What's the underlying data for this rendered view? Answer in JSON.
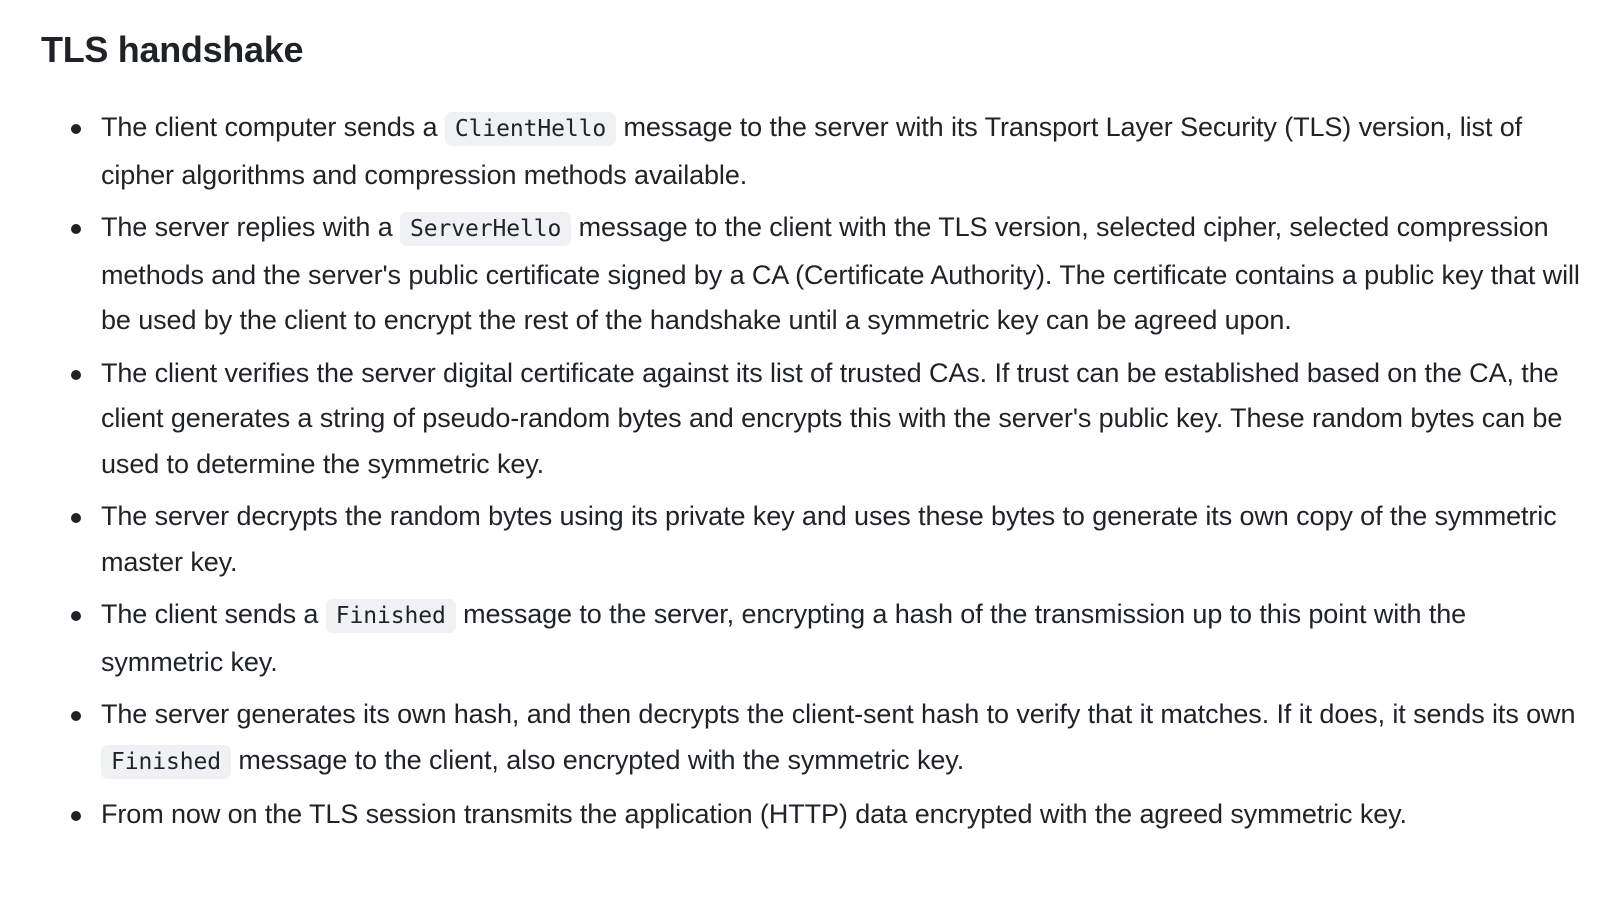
{
  "heading": "TLS handshake",
  "items": [
    {
      "before": "The client computer sends a ",
      "code": "ClientHello",
      "after": " message to the server with its Transport Layer Security (TLS) version, list of cipher algorithms and compression methods available."
    },
    {
      "before": "The server replies with a ",
      "code": "ServerHello",
      "after": " message to the client with the TLS version, selected cipher, selected compression methods and the server's public certificate signed by a CA (Certificate Authority). The certificate contains a public key that will be used by the client to encrypt the rest of the handshake until a symmetric key can be agreed upon."
    },
    {
      "before": "The client verifies the server digital certificate against its list of trusted CAs. If trust can be established based on the CA, the client generates a string of pseudo-random bytes and encrypts this with the server's public key. These random bytes can be used to determine the symmetric key."
    },
    {
      "before": "The server decrypts the random bytes using its private key and uses these bytes to generate its own copy of the symmetric master key."
    },
    {
      "before": "The client sends a ",
      "code": "Finished",
      "after": " message to the server, encrypting a hash of the transmission up to this point with the symmetric key."
    },
    {
      "before": "The server generates its own hash, and then decrypts the client-sent hash to verify that it matches. If it does, it sends its own ",
      "code": "Finished",
      "after": " message to the client, also encrypted with the symmetric key."
    },
    {
      "before": "From now on the TLS session transmits the application (HTTP) data encrypted with the agreed symmetric key."
    }
  ]
}
